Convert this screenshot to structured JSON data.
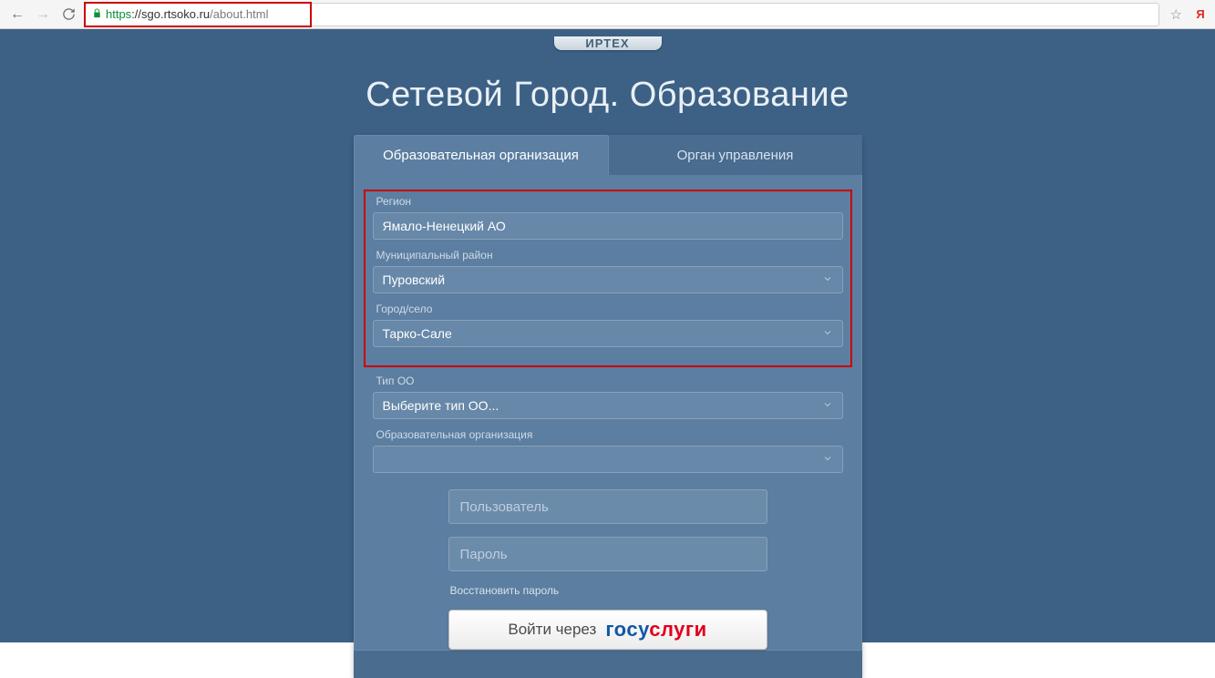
{
  "browser": {
    "url_proto": "https",
    "url_host": "://sgo.rtsoko.ru",
    "url_path": "/about.html"
  },
  "logo_text": "ИРТЕХ",
  "title": "Сетевой Город. Образование",
  "tabs": {
    "org": "Образовательная организация",
    "gov": "Орган управления"
  },
  "fields": {
    "region_label": "Регион",
    "region_value": "Ямало-Ненецкий АО",
    "district_label": "Муниципальный район",
    "district_value": "Пуровский",
    "city_label": "Город/село",
    "city_value": "Тарко-Сале",
    "type_label": "Тип ОО",
    "type_value": "Выберите тип ОО...",
    "org_label": "Образовательная организация",
    "org_value": ""
  },
  "login": {
    "user_placeholder": "Пользователь",
    "pass_placeholder": "Пароль",
    "restore": "Восстановить пароль",
    "gos_prefix": "Войти через",
    "gos_blue": "госу",
    "gos_red": "слуги"
  }
}
